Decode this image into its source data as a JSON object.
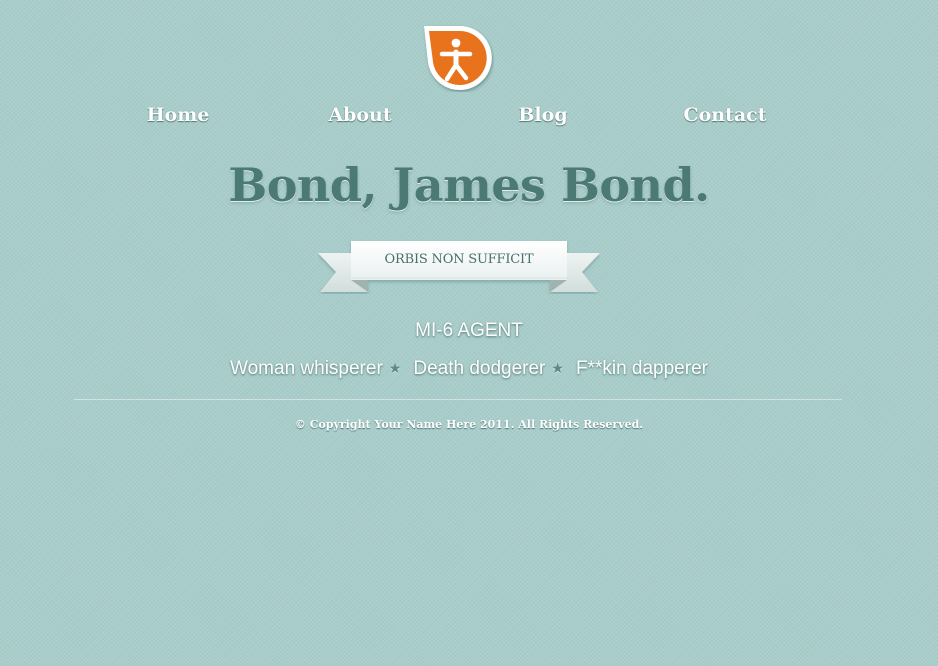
{
  "colors": {
    "background": "#a9cdca",
    "headline": "#4b7974",
    "logo_orange": "#e8731f",
    "ribbon_text": "#4b6f6c"
  },
  "logo": {
    "icon": "running-figure-icon"
  },
  "nav": {
    "items": [
      {
        "label": "Home"
      },
      {
        "label": "About"
      },
      {
        "label": "Blog"
      },
      {
        "label": "Contact"
      }
    ]
  },
  "hero": {
    "headline": "Bond, James Bond.",
    "ribbon_text": "ORBIS NON SUFFICIT",
    "role": "MI-6 AGENT",
    "traits": [
      "Woman whisperer",
      "Death dodgerer",
      "F**kin dapperer"
    ],
    "separator_icon": "star-icon"
  },
  "footer": {
    "copyright": "© Copyright Your Name Here 2011. All Rights Reserved."
  }
}
